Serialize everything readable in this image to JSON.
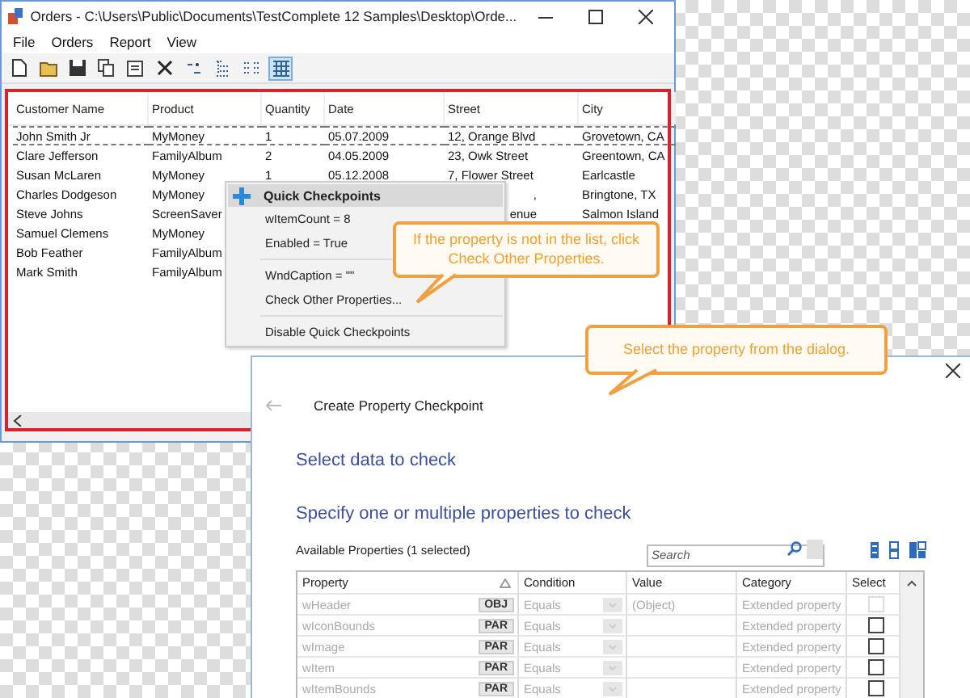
{
  "orders_window": {
    "title": "Orders - C:\\Users\\Public\\Documents\\TestComplete 12 Samples\\Desktop\\Orde...",
    "menu": [
      "File",
      "Orders",
      "Report",
      "View"
    ],
    "toolbar": [
      {
        "kind": "new",
        "selected": false
      },
      {
        "kind": "open",
        "selected": false
      },
      {
        "kind": "save",
        "selected": false
      },
      {
        "kind": "copy",
        "selected": false
      },
      {
        "kind": "properties",
        "selected": false
      },
      {
        "kind": "delete",
        "selected": false
      },
      {
        "kind": "sort",
        "selected": false
      },
      {
        "kind": "tree",
        "selected": false
      },
      {
        "kind": "list",
        "selected": false
      },
      {
        "kind": "grid",
        "selected": true
      }
    ],
    "table": {
      "columns": [
        "Customer Name",
        "Product",
        "Quantity",
        "Date",
        "Street",
        "City"
      ],
      "rows": [
        {
          "selected": true,
          "cells": [
            "John Smith Jr",
            "MyMoney",
            "1",
            "05.07.2009",
            "12, Orange Blvd",
            "Grovetown, CA"
          ]
        },
        {
          "selected": false,
          "cells": [
            "Clare Jefferson",
            "FamilyAlbum",
            "2",
            "04.05.2009",
            "23, Owk Street",
            "Greentown, CA"
          ]
        },
        {
          "selected": false,
          "cells": [
            "Susan McLaren",
            "MyMoney",
            "1",
            "05.12.2008",
            "7, Flower Street",
            "Earlcastle"
          ]
        },
        {
          "selected": false,
          "cells": [
            "Charles Dodgeson",
            "MyMoney",
            null,
            null,
            ",",
            "Bringtone, TX"
          ]
        },
        {
          "selected": false,
          "cells": [
            "Steve Johns",
            "ScreenSaver",
            null,
            null,
            "enue",
            "Salmon Island"
          ]
        },
        {
          "selected": false,
          "cells": [
            "Samuel Clemens",
            "MyMoney",
            null,
            null,
            null,
            null
          ]
        },
        {
          "selected": false,
          "cells": [
            "Bob Feather",
            "FamilyAlbum",
            null,
            null,
            null,
            null
          ]
        },
        {
          "selected": false,
          "cells": [
            "Mark Smith",
            "FamilyAlbum",
            null,
            null,
            null,
            null
          ]
        }
      ]
    }
  },
  "context_menu": {
    "title": "Quick Checkpoints",
    "groups": [
      [
        "wItemCount = 8",
        "Enabled = True"
      ],
      [
        "WndCaption = \"\"",
        "Check Other Properties..."
      ],
      [
        "Disable Quick Checkpoints"
      ]
    ]
  },
  "callouts": [
    "If the property is not in the list, click Check Other Properties.",
    "Select the property from the dialog."
  ],
  "dialog": {
    "title": "Create Property Checkpoint",
    "heading": "Select data to check",
    "subheading": "Specify one or multiple properties to check",
    "list_label": "Available Properties (1 selected)",
    "search": {
      "placeholder": "Search"
    },
    "columns": [
      "Property",
      "Condition",
      "Value",
      "Category",
      "Select"
    ],
    "rows": [
      {
        "property": "wHeader",
        "badge": "OBJ",
        "condition": "Equals",
        "value": "(Object)",
        "category": "Extended property",
        "checked": false,
        "disabled": true
      },
      {
        "property": "wIconBounds",
        "badge": "PAR",
        "condition": "Equals",
        "category": "Extended property",
        "checked": false,
        "disabled": false
      },
      {
        "property": "wImage",
        "badge": "PAR",
        "condition": "Equals",
        "category": "Extended property",
        "checked": false,
        "disabled": false
      },
      {
        "property": "wItem",
        "badge": "PAR",
        "condition": "Equals",
        "category": "Extended property",
        "checked": false,
        "disabled": false
      },
      {
        "property": "wItemBounds",
        "badge": "PAR",
        "condition": "Equals",
        "category": "Extended property",
        "checked": false,
        "disabled": false
      }
    ]
  }
}
